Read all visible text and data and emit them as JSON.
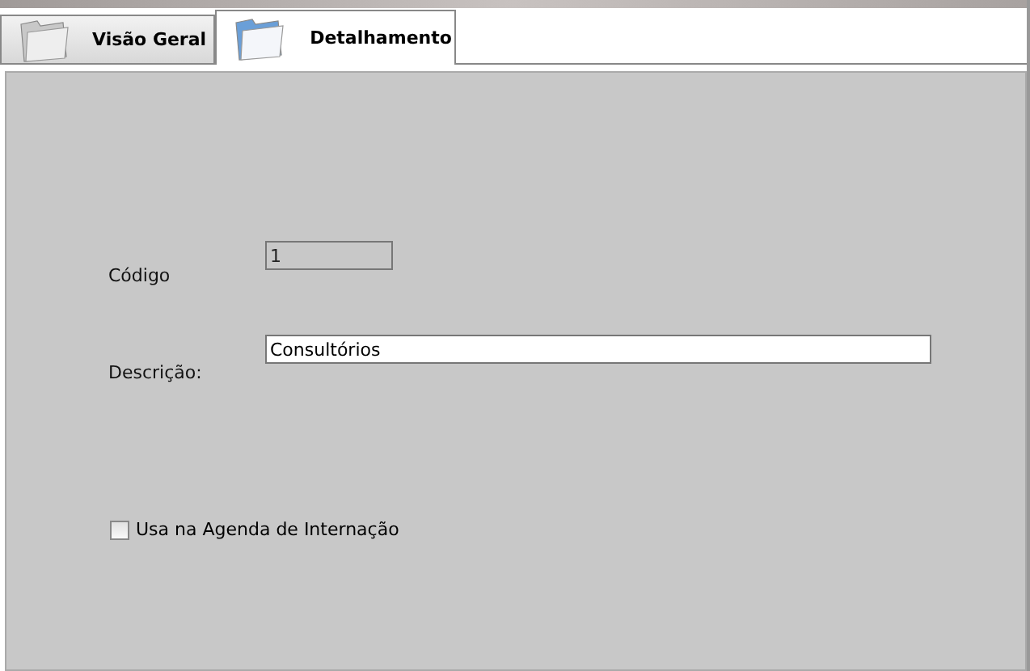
{
  "tabs": [
    {
      "label": "Visão Geral",
      "selected": false
    },
    {
      "label": "Detalhamento",
      "selected": true
    }
  ],
  "form": {
    "code": {
      "label": "Código",
      "value": "1",
      "disabled": true
    },
    "description": {
      "label": "Descrição:",
      "value": "Consultórios"
    },
    "agenda_option": {
      "label": "Usa na Agenda de Internação",
      "checked": false
    }
  }
}
